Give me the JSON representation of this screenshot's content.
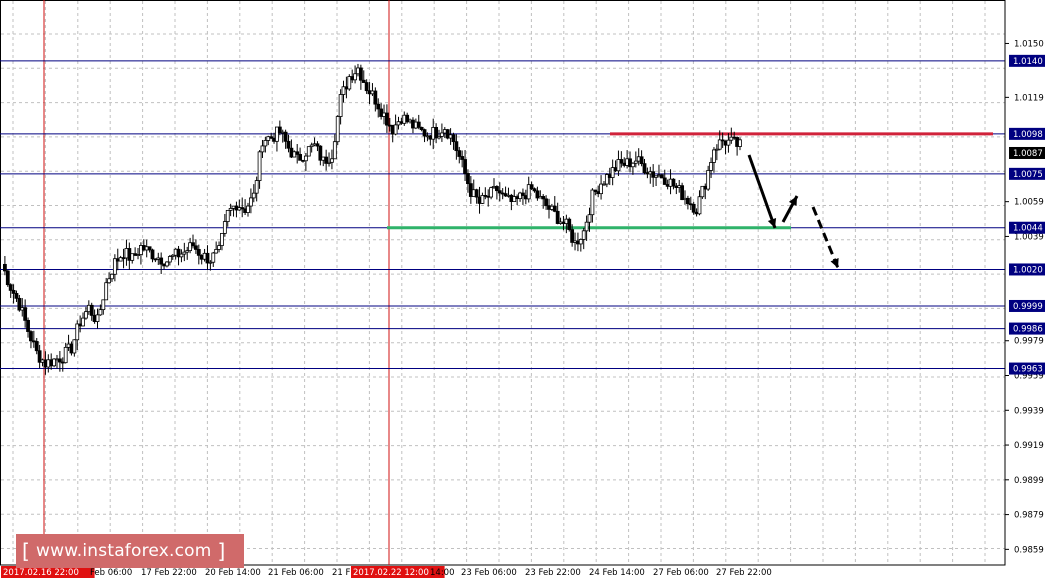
{
  "chart_data": {
    "type": "candlestick",
    "price_range": [
      0.985,
      1.0175
    ],
    "price_ticks": [
      "1.0150",
      "1.0119",
      "1.0098",
      "1.0087",
      "1.0075",
      "1.0059",
      "1.0044",
      "1.0039",
      "1.0020",
      "0.9999",
      "0.9986",
      "0.9979",
      "0.9963",
      "0.9959",
      "0.9939",
      "0.9919",
      "0.9899",
      "0.9879",
      "0.9859"
    ],
    "time_labels": [
      "2017.02.16 22:00",
      "Feb 06:00",
      "17 Feb 22:00",
      "20 Feb 14:00",
      "21 Feb 06:00",
      "21 F",
      "2017.02.22 12:00",
      "14:00",
      "23 Feb 06:00",
      "23 Feb 22:00",
      "24 Feb 14:00",
      "27 Feb 06:00",
      "27 Feb 22:00"
    ],
    "highlighted_times": [
      "2017.02.16 22:00",
      "2017.02.22 12:00"
    ],
    "levels": [
      {
        "price": 1.014,
        "label": "1.0140",
        "color": "#000080"
      },
      {
        "price": 1.0098,
        "label": "1.0098",
        "color": "#000080"
      },
      {
        "price": 1.0075,
        "label": "1.0075",
        "color": "#000080"
      },
      {
        "price": 1.0044,
        "label": "1.0044",
        "color": "#000080"
      },
      {
        "price": 1.002,
        "label": "1.0020",
        "color": "#000080"
      },
      {
        "price": 0.9999,
        "label": "0.9999",
        "color": "#000080"
      },
      {
        "price": 0.9986,
        "label": "0.9986",
        "color": "#000080"
      },
      {
        "price": 0.9963,
        "label": "0.9963",
        "color": "#000080"
      }
    ],
    "current_price": {
      "price": 1.0087,
      "label": "1.0087"
    },
    "resistance": {
      "price": 1.0098,
      "color": "#d0223a"
    },
    "support": {
      "price": 1.0044,
      "color": "#2fb36a"
    },
    "close_path": [
      1.0023,
      1.001,
      1.0,
      0.9985,
      0.9972,
      0.9966,
      0.9968,
      0.997,
      0.9975,
      0.999,
      0.9998,
      0.999,
      1.0012,
      1.0024,
      1.003,
      1.0026,
      1.0033,
      1.003,
      1.0027,
      1.0025,
      1.0028,
      1.003,
      1.0034,
      1.0028,
      1.0026,
      1.003,
      1.0052,
      1.0058,
      1.0055,
      1.0062,
      1.0095,
      1.0096,
      1.0099,
      1.009,
      1.0083,
      1.0088,
      1.0091,
      1.0082,
      1.0087,
      1.0118,
      1.0131,
      1.0136,
      1.0125,
      1.0118,
      1.0109,
      1.0101,
      1.0108,
      1.0104,
      1.01,
      1.0098,
      1.0099,
      1.0102,
      1.0094,
      1.008,
      1.0065,
      1.0058,
      1.0062,
      1.0066,
      1.006,
      1.0058,
      1.0063,
      1.0066,
      1.006,
      1.0055,
      1.005,
      1.0045,
      1.0035,
      1.0042,
      1.0062,
      1.007,
      1.0075,
      1.008,
      1.0081,
      1.0083,
      1.0079,
      1.0075,
      1.0074,
      1.007,
      1.0065,
      1.006,
      1.0055,
      1.007,
      1.009,
      1.0094,
      1.0093,
      1.0091
    ]
  },
  "watermark": {
    "left_bracket": "[",
    "text": "www.instaforex.com",
    "right_bracket": "]"
  },
  "colors": {
    "grid": "#c0c0c0",
    "level": "#000080",
    "axis": "#000000",
    "vline": "#d01010",
    "label_bg": "#000080"
  }
}
